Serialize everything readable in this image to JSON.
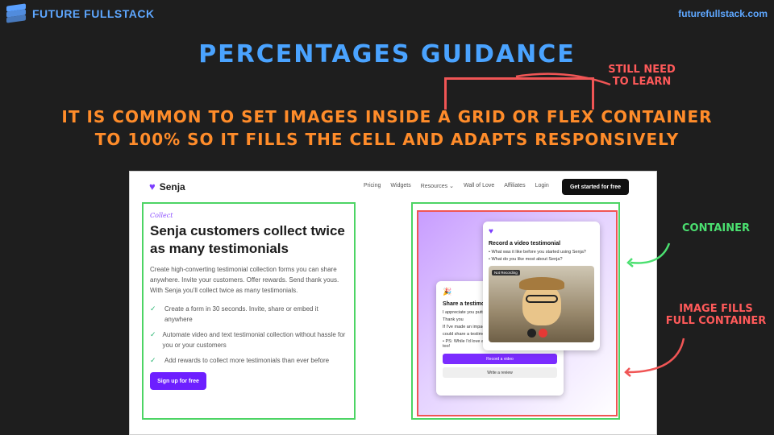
{
  "slide": {
    "brand": "FUTURE FULLSTACK",
    "site_url": "futurefullstack.com",
    "title": "PERCENTAGES GUIDANCE",
    "subtitle_line1": "IT IS COMMON TO SET IMAGES INSIDE A GRID OR FLEX CONTAINER",
    "subtitle_line2": "TO 100% SO IT FILLS THE CELL AND ADAPTS RESPONSIVELY",
    "note_learn_1": "STILL NEED",
    "note_learn_2": "TO LEARN",
    "note_container": "CONTAINER",
    "note_image_1": "IMAGE FILLS",
    "note_image_2": "FULL CONTAINER",
    "colors": {
      "background": "#1e1e1e",
      "title": "#4aa3ff",
      "subtitle": "#ff8c2a",
      "red": "#f05555",
      "green": "#4cd464"
    }
  },
  "senja": {
    "logo": "Senja",
    "nav": [
      "Pricing",
      "Widgets",
      "Resources ⌄",
      "Wall of Love",
      "Affiliates",
      "Login"
    ],
    "nav_cta": "Get started for free",
    "eyebrow": "Collect",
    "headline": "Senja customers collect twice as many testimonials",
    "lede": "Create high-converting testimonial collection forms you can share anywhere. Invite your customers. Offer rewards. Send thank yous. With Senja you'll collect twice as many testimonials.",
    "features": [
      "Create a form in 30 seconds. Invite, share or embed it anywhere",
      "Automate video and text testimonial collection without hassle for you or your customers",
      "Add rewards to collect more testimonials than ever before"
    ],
    "cta": "Sign up for free"
  },
  "cards": {
    "front_title": "Record a video testimonial",
    "front_q1": "• What was it like before you started using Senja?",
    "front_q2": "• What do you like most about Senja?",
    "rec_label": "Not Recording",
    "back_title": "Share a testimon",
    "back_p1": "I appreciate you putti",
    "back_p2": "Thank you",
    "back_p3": "If I've made an impact",
    "back_p4": "could share a testimo",
    "back_ps": "• PS: While I'd love a quick video, a text shoutout works too!",
    "record_btn": "Record a video",
    "review_btn": "Write a review"
  }
}
